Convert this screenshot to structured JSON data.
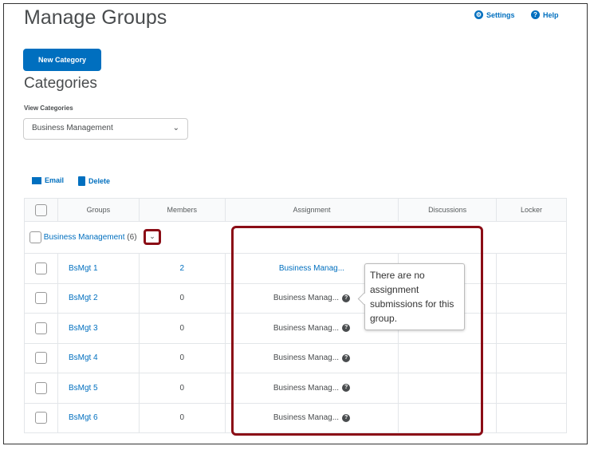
{
  "page_title": "Manage Groups",
  "header_links": {
    "settings": "Settings",
    "help": "Help"
  },
  "new_category_label": "New Category",
  "categories_heading": "Categories",
  "view_categories_label": "View Categories",
  "view_categories_value": "Business Management",
  "actions": {
    "email": "Email",
    "delete": "Delete"
  },
  "table": {
    "headers": [
      "Groups",
      "Members",
      "Assignment",
      "Discussions",
      "Locker"
    ],
    "category_row": {
      "name": "Business Management",
      "count": "(6)"
    },
    "rows": [
      {
        "group": "BsMgt 1",
        "members": "2",
        "assignment": "Business Manag..."
      },
      {
        "group": "BsMgt 2",
        "members": "0",
        "assignment": "Business Manag..."
      },
      {
        "group": "BsMgt 3",
        "members": "0",
        "assignment": "Business Manag..."
      },
      {
        "group": "BsMgt 4",
        "members": "0",
        "assignment": "Business Manag..."
      },
      {
        "group": "BsMgt 5",
        "members": "0",
        "assignment": "Business Manag..."
      },
      {
        "group": "BsMgt 6",
        "members": "0",
        "assignment": "Business Manag..."
      }
    ]
  },
  "tooltip": "There are no assignment submissions for this group.",
  "colors": {
    "accent": "#006fbf",
    "highlight": "#8b0d16"
  }
}
